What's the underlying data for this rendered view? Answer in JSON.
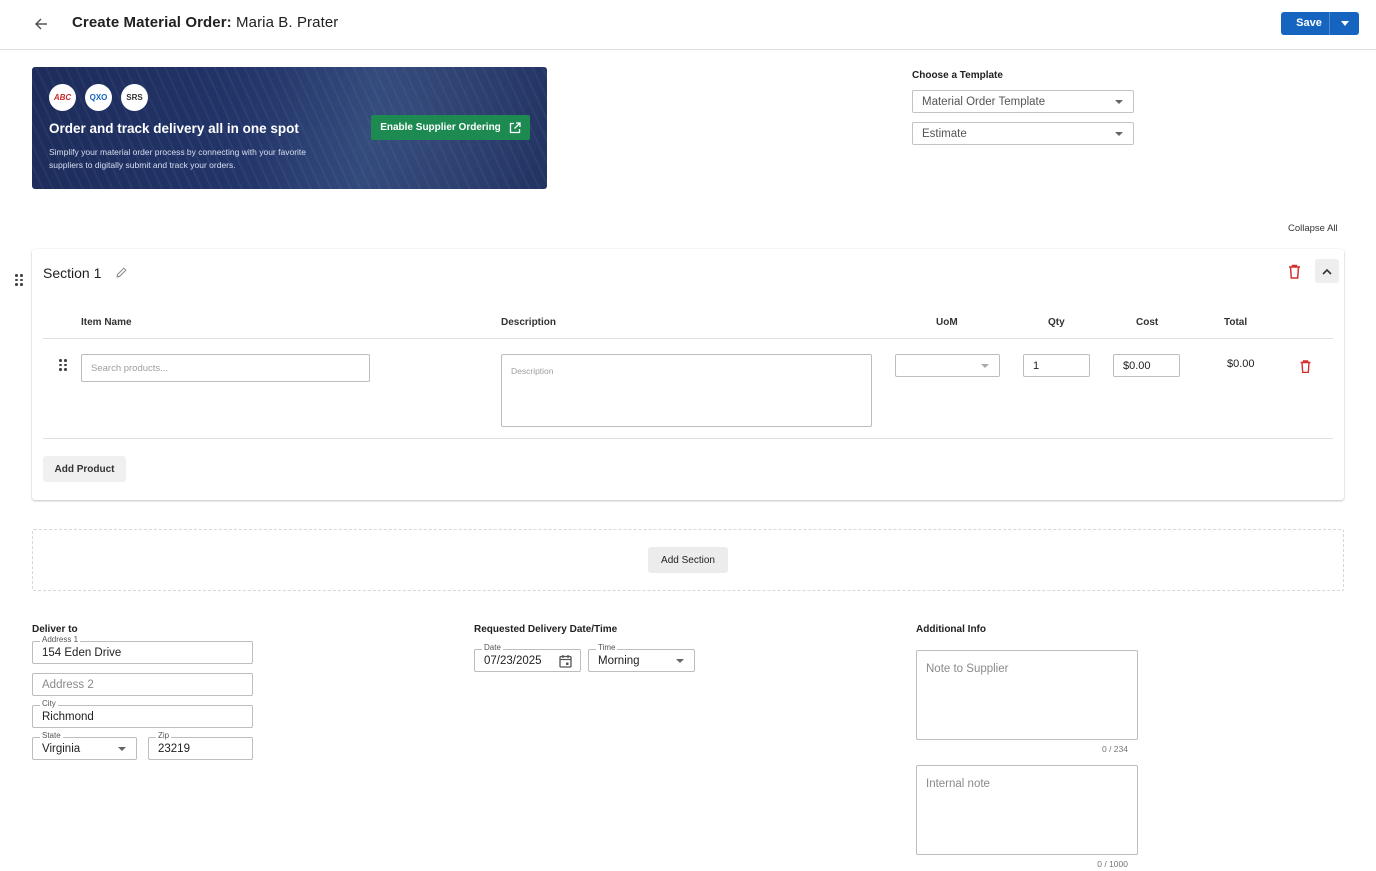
{
  "header": {
    "title_prefix": "Create Material Order:",
    "title_name": " Maria B. Prater",
    "save_label": "Save"
  },
  "banner": {
    "logos": [
      "ABC",
      "QXO",
      "SRS"
    ],
    "headline": "Order and track delivery all in one spot",
    "subtext": "Simplify your material order process by connecting with your favorite suppliers to digitally submit and track your orders.",
    "enable_label": "Enable Supplier Ordering"
  },
  "template": {
    "label": "Choose a Template",
    "template_value": "Material Order Template",
    "source_value": "Estimate"
  },
  "collapse_all_label": "Collapse All",
  "section": {
    "title": "Section 1",
    "columns": {
      "item_name": "Item Name",
      "description": "Description",
      "uom": "UoM",
      "qty": "Qty",
      "cost": "Cost",
      "total": "Total"
    },
    "row": {
      "item_placeholder": "Search products...",
      "description_placeholder": "Description",
      "uom_value": "",
      "qty_value": "1",
      "cost_value": "$0.00",
      "total_value": "$0.00"
    },
    "add_product_label": "Add Product"
  },
  "add_section_label": "Add Section",
  "deliver_to": {
    "label": "Deliver to",
    "address1_label": "Address 1",
    "address1_value": "154 Eden Drive",
    "address2_placeholder": "Address 2",
    "city_label": "City",
    "city_value": "Richmond",
    "state_label": "State",
    "state_value": "Virginia",
    "zip_label": "Zip",
    "zip_value": "23219"
  },
  "delivery": {
    "label": "Requested Delivery Date/Time",
    "date_label": "Date",
    "date_value": "07/23/2025",
    "time_label": "Time",
    "time_value": "Morning"
  },
  "additional": {
    "label": "Additional Info",
    "note_placeholder": "Note to Supplier",
    "note_counter": "0 / 234",
    "internal_placeholder": "Internal note",
    "internal_counter": "0 / 1000"
  },
  "colors": {
    "primary": "#1565c0",
    "enable_green": "#1d8a52",
    "delete_red": "#d32f2f",
    "banner_navy": "#1d2c5a"
  },
  "icons": [
    "back-arrow-icon",
    "chevron-down-icon",
    "external-link-icon",
    "pencil-icon",
    "trash-icon",
    "chevron-up-icon",
    "drag-handle-icon",
    "calendar-icon"
  ]
}
